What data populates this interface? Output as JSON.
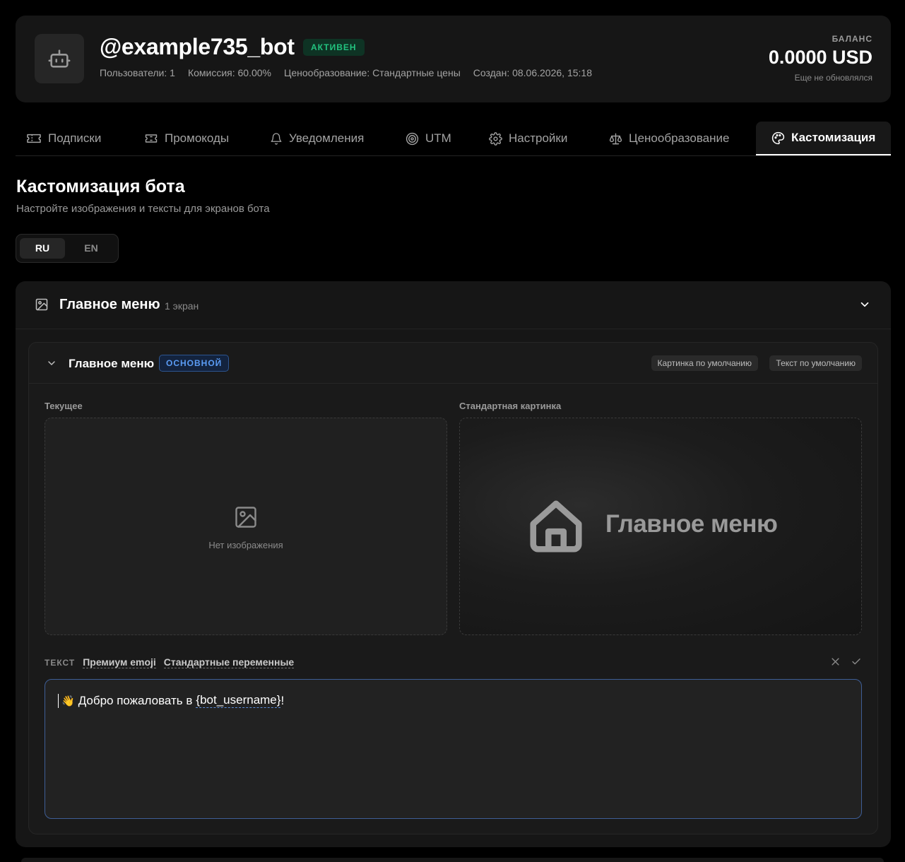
{
  "header": {
    "bot_name": "@example735_bot",
    "status": "АКТИВЕН",
    "meta": {
      "users": "Пользователи: 1",
      "commission": "Комиссия: 60.00%",
      "pricing": "Ценообразование: Стандартные цены",
      "created": "Создан: 08.06.2026, 15:18"
    },
    "balance": {
      "label": "БАЛАНС",
      "value": "0.0000 USD",
      "note": "Еще не обновлялся"
    }
  },
  "tabs": [
    {
      "label": "Подписки",
      "icon": "ticket-icon"
    },
    {
      "label": "Промокоды",
      "icon": "coupon-icon"
    },
    {
      "label": "Уведомления",
      "icon": "bell-icon"
    },
    {
      "label": "UTM",
      "icon": "target-icon"
    },
    {
      "label": "Настройки",
      "icon": "gear-icon"
    },
    {
      "label": "Ценообразование",
      "icon": "scales-icon"
    },
    {
      "label": "Кастомизация",
      "icon": "palette-icon",
      "active": true
    }
  ],
  "page": {
    "title": "Кастомизация бота",
    "subtitle": "Настройте изображения и тексты для экранов бота"
  },
  "languages": {
    "ru": "RU",
    "en": "EN",
    "selected": "RU"
  },
  "section": {
    "title": "Главное меню",
    "count": "1 экран",
    "screen": {
      "title": "Главное меню",
      "badge": "ОСНОВНОЙ",
      "default_image_button": "Картинка по умолчанию",
      "default_text_button": "Текст по умолчанию",
      "current_label": "Текущее",
      "no_image_text": "Нет изображения",
      "standard_label": "Стандартная картинка",
      "standard_image_title": "Главное меню",
      "text_label": "ТЕКСТ",
      "premium_emoji_link": "Премиум emoji",
      "variables_link": "Стандартные переменные",
      "editor": {
        "emoji": "👋",
        "text": "Добро пожаловать в",
        "variable": "{bot_username}",
        "suffix": "!"
      }
    }
  },
  "colors": {
    "accent_blue": "#5b9cf5",
    "status_green": "#22c37f",
    "background": "#000000",
    "card": "#161616"
  }
}
